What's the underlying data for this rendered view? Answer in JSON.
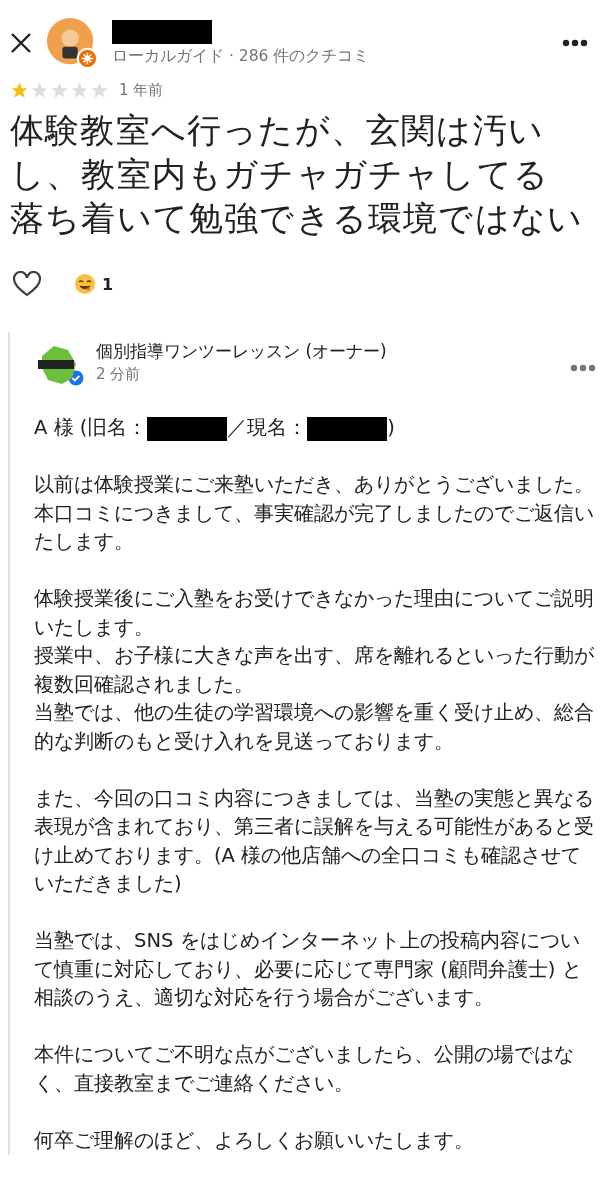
{
  "reviewer": {
    "name": [
      {
        "kind": "redacted"
      }
    ],
    "meta": "ローカルガイド · 286 件のクチコミ"
  },
  "review": {
    "stars": 1,
    "time": "1 年前",
    "lines": [
      "体験教室へ行ったが、玄関は汚いし、教室内もガチャガチャしてる",
      "落ち着いて勉強できる環境ではない"
    ]
  },
  "reactions": {
    "count": "1"
  },
  "owner_reply": {
    "name": "個別指導ワンツーレッスン (オーナー)",
    "verified": true,
    "time": "2 分前",
    "greeting": [
      {
        "kind": "text",
        "text": "A 様 (旧名："
      },
      {
        "kind": "redacted"
      },
      {
        "kind": "text",
        "text": "／現名："
      },
      {
        "kind": "redacted"
      },
      {
        "kind": "text",
        "text": ")"
      }
    ],
    "paragraphs": [
      [
        "以前は体験授業にご来塾いただき、ありがとうございました。",
        "本口コミにつきまして、事実確認が完了しましたのでご返信いたします。"
      ],
      [
        "体験授業後にご入塾をお受けできなかった理由についてご説明いたします。",
        "授業中、お子様に大きな声を出す、席を離れるといった行動が複数回確認されました。",
        "当塾では、他の生徒の学習環境への影響を重く受け止め、総合的な判断のもと受け入れを見送っております。"
      ],
      [
        "また、今回の口コミ内容につきましては、当塾の実態と異なる表現が含まれており、第三者に誤解を与える可能性があると受け止めております。(A 様の他店舗への全口コミも確認させていただきました)"
      ],
      [
        "当塾では、SNS をはじめインターネット上の投稿内容について慎重に対応しており、必要に応じて専門家 (顧問弁護士) と相談のうえ、適切な対応を行う場合がございます。"
      ],
      [
        "本件についてご不明な点がございましたら、公開の場ではなく、直接教室までご連絡ください。"
      ],
      [
        "何卒ご理解のほど、よろしくお願いいたします。"
      ]
    ]
  }
}
